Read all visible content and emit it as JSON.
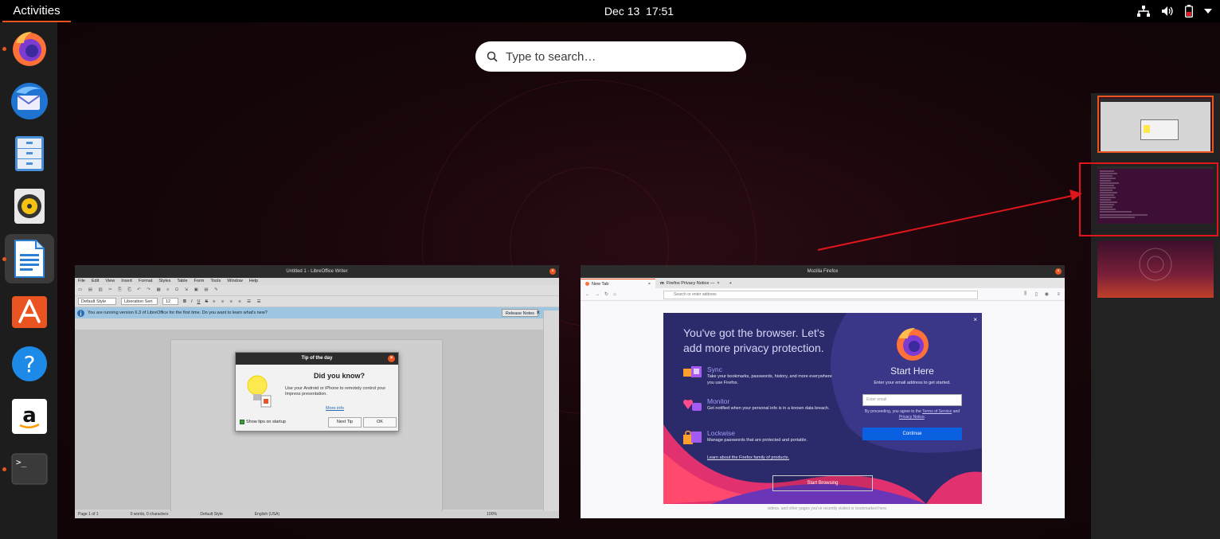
{
  "topbar": {
    "activities_label": "Activities",
    "date": "Dec 13",
    "time": "17:51",
    "tray_icons": [
      "network-wired-icon",
      "volume-icon",
      "battery-icon",
      "system-menu-arrow-icon"
    ]
  },
  "dock": {
    "apps": [
      {
        "name": "Firefox",
        "icon": "firefox-icon",
        "running": true
      },
      {
        "name": "Thunderbird",
        "icon": "thunderbird-icon",
        "running": false
      },
      {
        "name": "Files",
        "icon": "files-icon",
        "running": false
      },
      {
        "name": "Rhythmbox",
        "icon": "rhythmbox-icon",
        "running": false
      },
      {
        "name": "LibreOffice Writer",
        "icon": "writer-icon",
        "running": true,
        "active": true
      },
      {
        "name": "Ubuntu Software",
        "icon": "software-icon",
        "running": false
      },
      {
        "name": "Help",
        "icon": "help-icon",
        "running": false
      },
      {
        "name": "Amazon",
        "icon": "amazon-icon",
        "running": false
      },
      {
        "name": "Terminal",
        "icon": "terminal-icon",
        "running": true
      }
    ]
  },
  "search": {
    "placeholder": "Type to search…"
  },
  "writer": {
    "title": "Untitled 1 - LibreOffice Writer",
    "menu": [
      "File",
      "Edit",
      "View",
      "Insert",
      "Format",
      "Styles",
      "Table",
      "Form",
      "Tools",
      "Window",
      "Help"
    ],
    "style_value": "Default Style",
    "font_value": "Liberation Seri",
    "size_value": "12",
    "infobar_text": "You are running version 6.3 of LibreOffice for the first time. Do you want to learn what's new?",
    "release_notes": "Release Notes",
    "status": [
      "Page 1 of 1",
      "0 words, 0 characters",
      "Default Style",
      "English (USA)",
      "100%"
    ],
    "tip": {
      "title": "Tip of the day",
      "heading": "Did you know?",
      "body": "Use your Android or iPhone to remotely control your Impress presentation.",
      "more_info": "More info",
      "show_tips": "Show tips on startup",
      "next_tip": "Next Tip",
      "ok": "OK"
    }
  },
  "firefox": {
    "title": "Mozilla Firefox",
    "tabs": [
      "New Tab",
      "Firefox Privacy Notice —"
    ],
    "url_placeholder": "Search or enter address",
    "modal": {
      "headline": "You've got the browser. Let's add more privacy protection.",
      "features": [
        {
          "name": "Sync",
          "desc": "Take your bookmarks, passwords, history, and more everywhere you use Firefox."
        },
        {
          "name": "Monitor",
          "desc": "Get notified when your personal info is in a known data breach."
        },
        {
          "name": "Lockwise",
          "desc": "Manage passwords that are protected and portable."
        }
      ],
      "learn_more": "Learn about the Firefox family of products.",
      "start_browsing": "Start Browsing",
      "start_here": "Start Here",
      "start_sub": "Enter your email address to get started.",
      "email_placeholder": "Enter email",
      "terms_prefix": "By proceeding, you agree to the",
      "terms_link": "Terms of Service",
      "terms_and": "and",
      "privacy_link": "Privacy Notice",
      "continue": "Continue"
    },
    "footer_text": "videos, and other pages you've recently visited or bookmarked here."
  },
  "workspaces": {
    "count": 3,
    "selected_index": 0
  },
  "colors": {
    "accent": "#e95420",
    "annotation": "#e0161c",
    "dock_bg": "#1d1d1d"
  }
}
